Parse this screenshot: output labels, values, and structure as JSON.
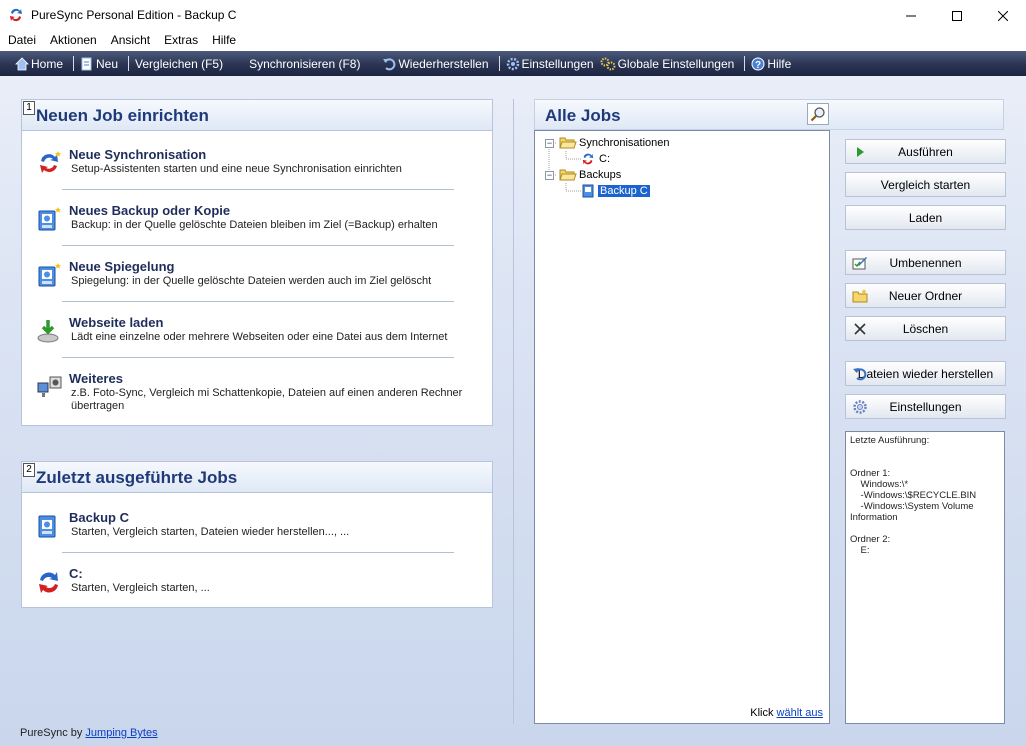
{
  "window": {
    "title": "PureSync Personal Edition  -  Backup C",
    "min": "—",
    "max": "☐",
    "close": "✕"
  },
  "menu": [
    "Datei",
    "Aktionen",
    "Ansicht",
    "Extras",
    "Hilfe"
  ],
  "toolbar": {
    "home": "Home",
    "new": "Neu",
    "compare": "Vergleichen (F5)",
    "sync": "Synchronisieren (F8)",
    "restore": "Wiederherstellen",
    "settings": "Einstellungen",
    "global_settings": "Globale Einstellungen",
    "help": "Hilfe"
  },
  "new_job": {
    "number": "1",
    "title": "Neuen Job einrichten",
    "entries": [
      {
        "title": "Neue Synchronisation",
        "desc": "Setup-Assistenten starten und eine neue Synchronisation einrichten",
        "icon": "sync-new-icon"
      },
      {
        "title": "Neues Backup oder Kopie",
        "desc": "Backup: in der Quelle gelöschte Dateien bleiben im Ziel (=Backup) erhalten",
        "icon": "backup-new-icon"
      },
      {
        "title": "Neue Spiegelung",
        "desc": "Spiegelung: in der Quelle gelöschte Dateien werden auch im Ziel gelöscht",
        "icon": "mirror-new-icon"
      },
      {
        "title": "Webseite laden",
        "desc": "Lädt eine einzelne oder mehrere Webseiten oder eine Datei aus dem Internet",
        "icon": "web-download-icon"
      },
      {
        "title": "Weiteres",
        "desc": "z.B. Foto-Sync, Vergleich mi Schattenkopie, Dateien auf einen anderen Rechner übertragen",
        "icon": "more-icon"
      }
    ]
  },
  "recent_jobs": {
    "number": "2",
    "title": "Zuletzt ausgeführte Jobs",
    "entries": [
      {
        "title": "Backup C",
        "desc": "Starten, Vergleich starten, Dateien wieder herstellen..., ...",
        "icon": "backup-job-icon"
      },
      {
        "title": "C:",
        "desc": "Starten, Vergleich starten, ...",
        "icon": "sync-job-icon"
      }
    ]
  },
  "footer": {
    "text": "PureSync by ",
    "link": "Jumping Bytes"
  },
  "all_jobs": {
    "title": "Alle Jobs",
    "tree": {
      "group1": "Synchronisationen",
      "group1_item": "C:",
      "group2": "Backups",
      "group2_item": "Backup C"
    },
    "hint_prefix": "Klick ",
    "hint_link": "wählt aus"
  },
  "buttons": {
    "run": "Ausführen",
    "compare": "Vergleich starten",
    "load": "Laden",
    "rename": "Umbenennen",
    "new_folder": "Neuer Ordner",
    "delete": "Löschen",
    "restore": "Dateien wieder herstellen",
    "settings": "Einstellungen"
  },
  "info": {
    "text": "Letzte Ausführung:\n\n\nOrdner 1:\n    Windows:\\*\n    -Windows:\\$RECYCLE.BIN\n    -Windows:\\System Volume\nInformation\n\nOrdner 2:\n    E:"
  }
}
